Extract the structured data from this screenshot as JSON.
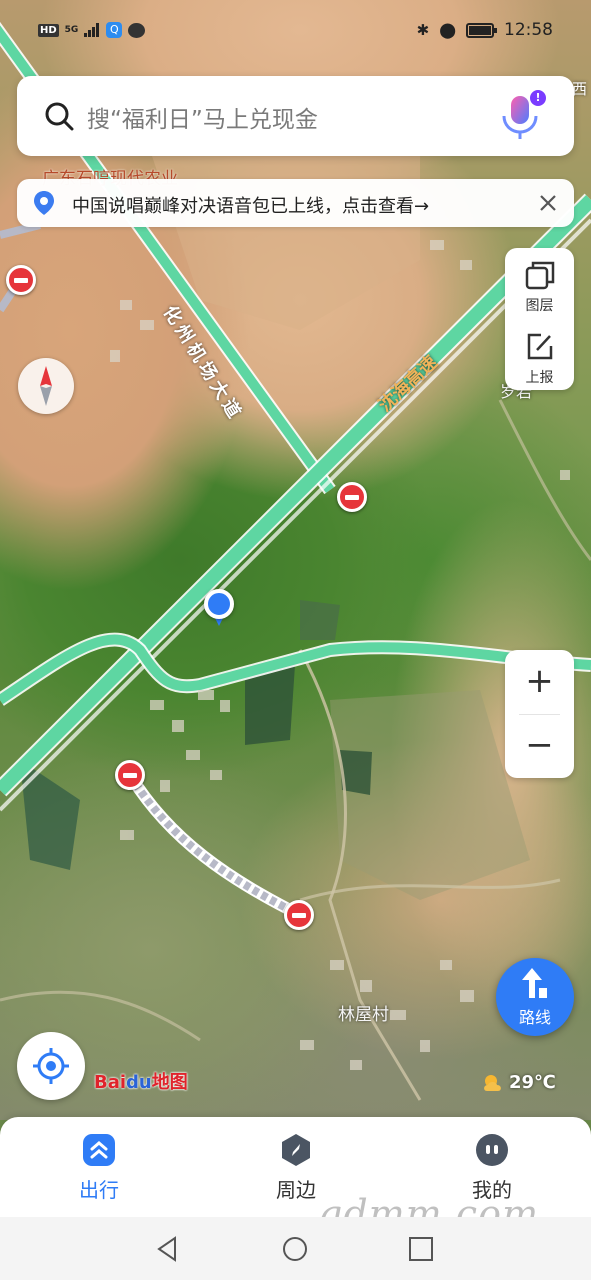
{
  "status_bar": {
    "hd": "HD",
    "network": "5G",
    "time": "12:58"
  },
  "search": {
    "placeholder": "搜“福利日”马上兑现金",
    "badge": "!"
  },
  "notice": {
    "text": "中国说唱巅峰对决语音包已上线，点击查看→"
  },
  "tools": {
    "layers_label": "图层",
    "report_label": "上报"
  },
  "zoom": {
    "in_label": "+",
    "out_label": "−"
  },
  "map": {
    "labels": {
      "airport_road": "化州机场大道",
      "highway": "沈海高速",
      "village": "林屋村",
      "partial_right": "岁岩",
      "top_left": "广东石哼现代农业",
      "east": "西"
    }
  },
  "route": {
    "label": "路线"
  },
  "branding": {
    "logo_text": "Bai",
    "logo_paw": "du",
    "logo_suffix": "地图"
  },
  "weather": {
    "temperature": "29℃",
    "icon": "partly-cloudy-icon"
  },
  "tabs": [
    {
      "label": "出行",
      "icon": "travel-icon",
      "active": true
    },
    {
      "label": "周边",
      "icon": "compass-nearby-icon",
      "active": false
    },
    {
      "label": "我的",
      "icon": "profile-icon",
      "active": false
    }
  ],
  "watermark": "gdmm.com",
  "colors": {
    "accent": "#2f7cf6",
    "road_green": "#5ed6a2",
    "restriction_red": "#e6353b"
  }
}
